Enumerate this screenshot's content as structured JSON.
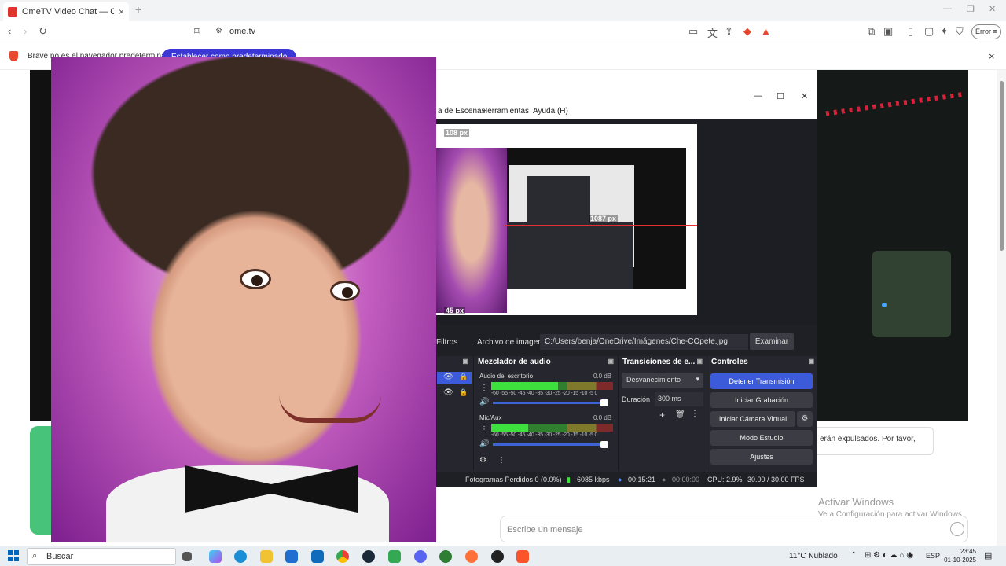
{
  "browser": {
    "tab_title": "OmeTV Video Chat — Omegle",
    "tab_close": "×",
    "new_tab": "+",
    "url": "ome.tv",
    "error_label": "Error",
    "infobar": {
      "message": "Brave no es el navegador predeterminado",
      "cta": "Establecer como predeterminado",
      "close": "×"
    }
  },
  "page": {
    "chat_message": "erán expulsados. Por favor,",
    "message_placeholder": "Escribe un mensaje",
    "activate_windows": {
      "line1": "Activar Windows",
      "line2": "Ve a Configuración para activar Windows."
    }
  },
  "obs": {
    "menu": [
      "a de Escenas",
      "Herramientas",
      "Ayuda (H)"
    ],
    "preview_labels": {
      "top": "108 px",
      "right": "1087 px",
      "bottom": "45 px"
    },
    "source_bar": {
      "filters": "Filtros",
      "image_file_label": "Archivo de imagen",
      "path": "C:/Users/benja/OneDrive/Imágenes/Che-COpete.jpg",
      "browse": "Examinar"
    },
    "mixer": {
      "title": "Mezclador de audio",
      "channels": [
        {
          "name": "Audio del escritorio",
          "db": "0.0 dB",
          "level": 0.55
        },
        {
          "name": "Mic/Aux",
          "db": "0.0 dB",
          "level": 0.3
        }
      ],
      "ticks": "-60 -55 -50 -45 -40 -35 -30 -25 -20 -15 -10 -5 0"
    },
    "transitions": {
      "title": "Transiciones de e...",
      "type": "Desvanecimiento",
      "duration_label": "Duración",
      "duration_value": "300 ms"
    },
    "controls": {
      "title": "Controles",
      "buttons": [
        "Detener Transmisión",
        "Iniciar Grabación",
        "Iniciar Cámara Virtual",
        "Modo Estudio",
        "Ajustes"
      ]
    },
    "status": {
      "frames_lost": "Fotogramas Perdidos 0 (0.0%)",
      "bitrate": "6085 kbps",
      "stream_time": "00:15:21",
      "rec_time": "00:00:00",
      "cpu": "CPU: 2.9%",
      "fps": "30.00 / 30.00 FPS"
    }
  },
  "taskbar": {
    "search": "Buscar",
    "weather": "11°C  Nublado",
    "lang": "ESP",
    "time": "23:45",
    "date": "01-10-2025"
  }
}
